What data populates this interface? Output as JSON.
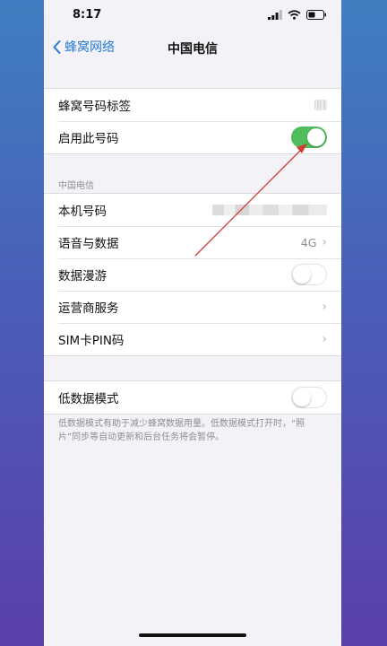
{
  "status_bar": {
    "time": "8:17"
  },
  "nav": {
    "back_label": "蜂窝网络",
    "title": "中国电信"
  },
  "group1": [
    {
      "label": "蜂窝号码标签"
    },
    {
      "label": "启用此号码",
      "toggle": "on"
    }
  ],
  "section_header": "中国电信",
  "group2": [
    {
      "label": "本机号码"
    },
    {
      "label": "语音与数据",
      "value": "4G"
    },
    {
      "label": "数据漫游",
      "toggle": "off"
    },
    {
      "label": "运营商服务"
    },
    {
      "label": "SIM卡PIN码"
    }
  ],
  "group3": [
    {
      "label": "低数据模式",
      "toggle": "off"
    }
  ],
  "footnote": "低数据模式有助于减少蜂窝数据用量。低数据模式打开时，“照片”同步等自动更新和后台任务将会暂停。",
  "colors": {
    "accent": "#2a7bd6",
    "toggle_on": "#4fbd5c",
    "annotation": "#d23c32"
  }
}
